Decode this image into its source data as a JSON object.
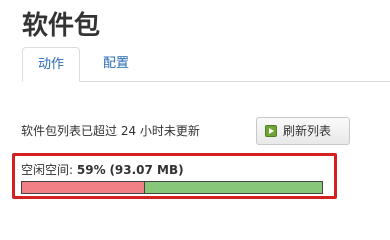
{
  "page": {
    "title": "软件包"
  },
  "tabs": [
    {
      "label": "动作",
      "active": true
    },
    {
      "label": "配置",
      "active": false
    }
  ],
  "status": {
    "message": "软件包列表已超过 24 小时未更新"
  },
  "refresh_button": {
    "label": "刷新列表",
    "icon": "refresh-icon"
  },
  "free_space": {
    "label": "空闲空间:",
    "percent_text": "59%",
    "size_text": "(93.07 MB)",
    "free_fraction": 0.59
  },
  "colors": {
    "used": "#f07f86",
    "free": "#86c77a",
    "highlight": "#d42020",
    "link": "#2a6ab4"
  }
}
